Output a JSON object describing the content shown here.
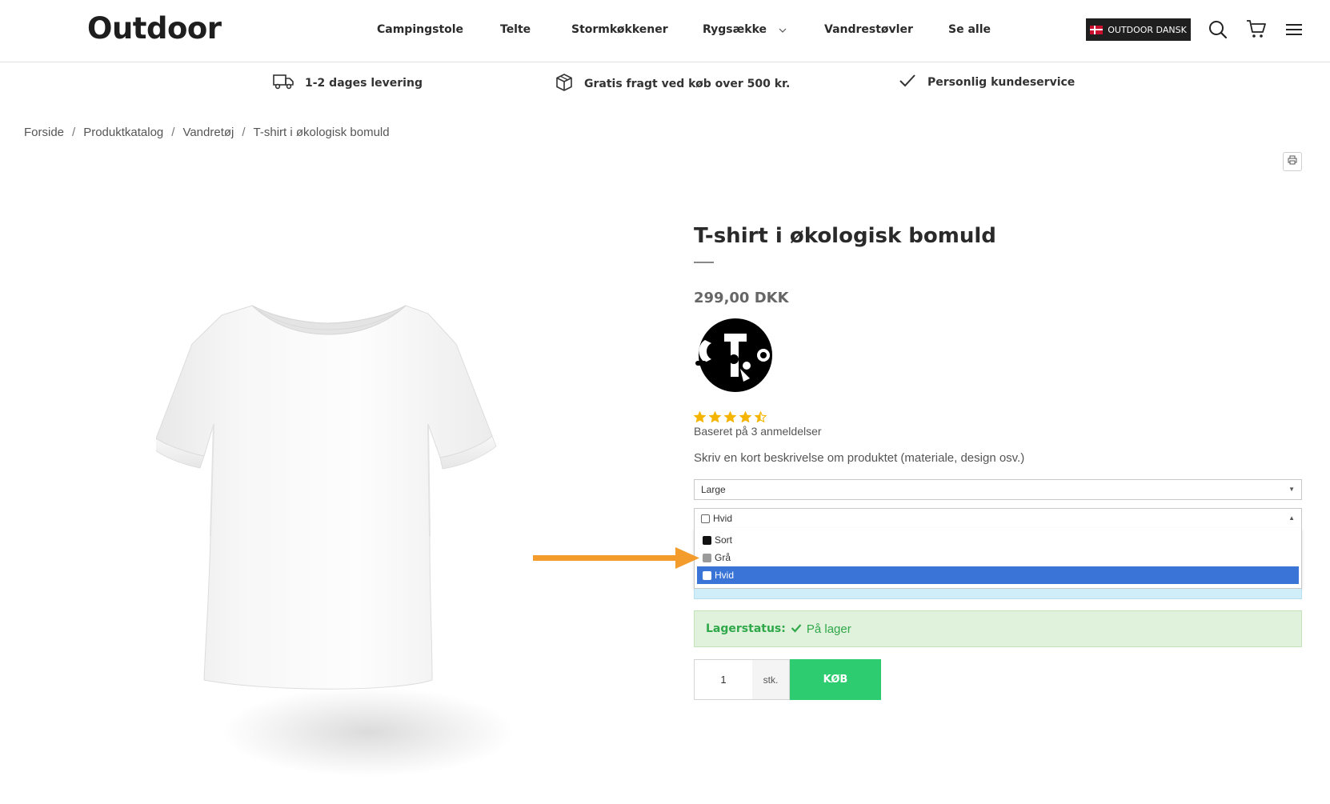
{
  "header": {
    "logo": "Outdoor",
    "nav": [
      "Campingstole",
      "Telte",
      "Stormkøkkener",
      "Rygsække",
      "Vandrestøvler",
      "Se alle"
    ],
    "language_button": "OUTDOOR DANSK",
    "icons": [
      "search-icon",
      "cart-icon",
      "menu-icon"
    ]
  },
  "usp": {
    "delivery": "1-2 dages levering",
    "shipping": "Gratis fragt ved køb over 500 kr.",
    "service": "Personlig kundeservice"
  },
  "breadcrumb": [
    "Forside",
    "Produktkatalog",
    "Vandretøj",
    "T-shirt i økologisk bomuld"
  ],
  "product": {
    "title": "T-shirt i økologisk bomuld",
    "price": "299,00 DKK",
    "rating": 4.5,
    "rating_max": 5,
    "reviews": "Baseret på 3 anmeldelser",
    "description": "Skriv en kort beskrivelse om produktet (materiale, design osv.)",
    "size_select": {
      "value": "Large"
    },
    "color_select": {
      "value": "Hvid",
      "options": [
        {
          "label": "Sort",
          "swatch": "#111111"
        },
        {
          "label": "Grå",
          "swatch": "#9a9a9a"
        },
        {
          "label": "Hvid",
          "swatch": "#ffffff"
        }
      ],
      "selected": "Hvid"
    },
    "stock": {
      "label": "Lagerstatus:",
      "value": "På lager"
    },
    "quantity": "1",
    "unit": "stk.",
    "buy_label": "KØB"
  },
  "colors": {
    "accent_green": "#2ecc71",
    "stock_green": "#2fa84a",
    "selection_blue": "#3a74d6",
    "annotation_orange": "#f39c2b",
    "star_yellow": "#f4b400"
  }
}
